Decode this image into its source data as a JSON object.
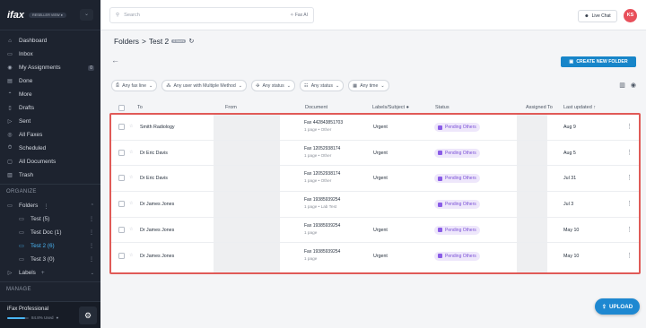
{
  "sidebar": {
    "logo": "ifax",
    "reseller_badge": "RESELLER VIEW",
    "nav": [
      {
        "label": "Dashboard",
        "icon": "home-icon"
      },
      {
        "label": "Inbox",
        "icon": "inbox-icon"
      },
      {
        "label": "My Assignments",
        "icon": "assignment-icon",
        "badge": "0"
      },
      {
        "label": "Done",
        "icon": "done-icon"
      },
      {
        "label": "More",
        "icon": "chevron-up-icon"
      },
      {
        "label": "Drafts",
        "icon": "draft-icon"
      },
      {
        "label": "Sent",
        "icon": "send-icon"
      },
      {
        "label": "All Faxes",
        "icon": "faxes-icon"
      },
      {
        "label": "Scheduled",
        "icon": "schedule-icon"
      },
      {
        "label": "All Documents",
        "icon": "documents-icon"
      },
      {
        "label": "Trash",
        "icon": "trash-icon"
      }
    ],
    "organize_header": "ORGANIZE",
    "folders_label": "Folders",
    "folders": [
      {
        "label": "Test (5)",
        "selected": false
      },
      {
        "label": "Test Doc (1)",
        "selected": false
      },
      {
        "label": "Test 2 (6)",
        "selected": true
      },
      {
        "label": "Test 3 (0)",
        "selected": false
      }
    ],
    "labels_label": "Labels",
    "labels_add": "+",
    "manage_header": "MANAGE",
    "plan_name": "iFax Professional",
    "plan_usage": "84.8% Used",
    "plan_fraction": 0.848
  },
  "topbar": {
    "search_placeholder": "Search",
    "fax_ai": "Fax AI",
    "live_chat": "Live Chat",
    "avatar_initials": "KS"
  },
  "header": {
    "folders": "Folders",
    "separator": ">",
    "folder_name": "Test 2",
    "count": "6 faxes"
  },
  "create_button": "CREATE NEW FOLDER",
  "filters": [
    "Any fax line",
    "Any user with Multiple Method",
    "Any status",
    "Any status",
    "Any time"
  ],
  "columns": {
    "to": "To",
    "from": "From",
    "document": "Document",
    "labels": "Labels/Subject",
    "status": "Status",
    "assigned": "Assigned To",
    "updated": "Last updated"
  },
  "rows": [
    {
      "to": "Smith Radiology",
      "fax": "Fax 442843851703",
      "meta": "1 page  •  Other",
      "label": "Urgent",
      "status": "Pending Others",
      "updated": "Aug 9"
    },
    {
      "to": "Dr Eric Davis",
      "fax": "Fax 12052938174",
      "meta": "1 page  •  Other",
      "label": "Urgent",
      "status": "Pending Others",
      "updated": "Aug 5"
    },
    {
      "to": "Dr Eric Davis",
      "fax": "Fax 12052938174",
      "meta": "1 page  •  Other",
      "label": "Urgent",
      "status": "Pending Others",
      "updated": "Jul 31"
    },
    {
      "to": "Dr James Jones",
      "fax": "Fax 19385939254",
      "meta": "1 page  •  Lab Test",
      "label": "",
      "status": "Pending Others",
      "updated": "Jul 3"
    },
    {
      "to": "Dr James Jones",
      "fax": "Fax 19385939254",
      "meta": "1 page",
      "label": "Urgent",
      "status": "Pending Others",
      "updated": "May 10"
    },
    {
      "to": "Dr James Jones",
      "fax": "Fax 19385939254",
      "meta": "1 page",
      "label": "Urgent",
      "status": "Pending Others",
      "updated": "May 10"
    }
  ],
  "upload_button": "UPLOAD",
  "colors": {
    "accent": "#1785c9",
    "sidebar": "#1d232f",
    "pending_bg": "#eee7fb",
    "pending_text": "#7a4fd6",
    "highlight": "#e05a57"
  }
}
